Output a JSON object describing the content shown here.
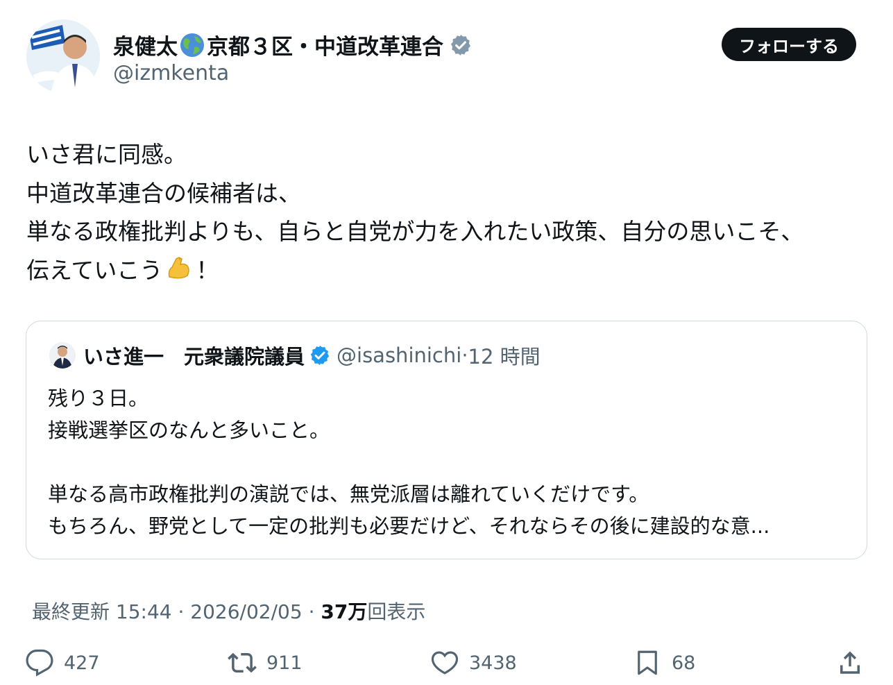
{
  "author": {
    "name_part1": "泉健太",
    "name_part2": "京都３区・中道改革連合",
    "handle": "@izmkenta",
    "avatar_icon": "person-photo",
    "badge": "verified-gray-icon"
  },
  "follow_label": "フォローする",
  "tweet_lines": [
    "いさ君に同感。",
    "中道改革連合の候補者は、",
    "単なる政権批判よりも、自らと自党が力を入れたい政策、自分の思いこそ、",
    "伝えていこう",
    "！"
  ],
  "quote": {
    "name": "いさ進一　元衆議院議員",
    "handle": "@isashinichi",
    "sep": "·",
    "time": "12 時間",
    "lines": [
      "残り３日。",
      "接戦選挙区のなんと多いこと。",
      "",
      "単なる高市政権批判の演説では、無党派層は離れていくだけです。",
      "もちろん、野党として一定の批判も必要だけど、それならその後に建設的な意..."
    ]
  },
  "meta": {
    "updated": "最終更新 15:44 · 2026/02/05",
    "dot": " · ",
    "views_count": "37万",
    "views_label": "回表示"
  },
  "actions": {
    "replies": "427",
    "reposts": "911",
    "likes": "3438",
    "bookmarks": "68"
  },
  "colors": {
    "text": "#0f1419",
    "secondary": "#536471",
    "border": "#cfd9de",
    "verified_blue": "#1d9bf0",
    "verified_gray": "#829aab"
  }
}
